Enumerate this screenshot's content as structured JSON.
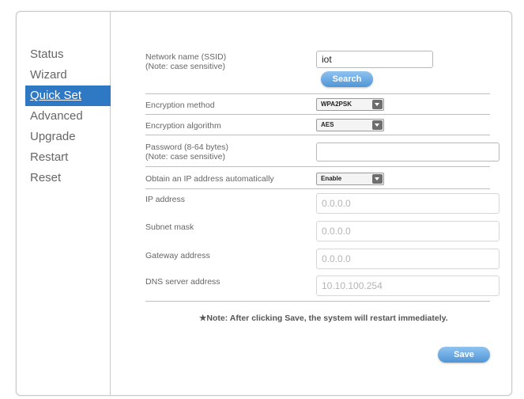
{
  "nav": {
    "items": [
      {
        "label": "Status"
      },
      {
        "label": "Wizard"
      },
      {
        "label": "Quick Set"
      },
      {
        "label": "Advanced"
      },
      {
        "label": "Upgrade"
      },
      {
        "label": "Restart"
      },
      {
        "label": "Reset"
      }
    ],
    "active_index": 2
  },
  "form": {
    "ssid": {
      "label": "Network name (SSID)",
      "sublabel": "(Note: case sensitive)",
      "value": "iot"
    },
    "search_button": "Search",
    "encryption_method": {
      "label": "Encryption method",
      "value": "WPA2PSK"
    },
    "encryption_algorithm": {
      "label": "Encryption algorithm",
      "value": "AES"
    },
    "password": {
      "label": "Password (8-64 bytes)",
      "sublabel": "(Note: case sensitive)",
      "value": ""
    },
    "obtain_ip": {
      "label": "Obtain an IP address automatically",
      "value": "Enable"
    },
    "ip_address": {
      "label": "IP address",
      "value": "0.0.0.0"
    },
    "subnet_mask": {
      "label": "Subnet mask",
      "value": "0.0.0.0"
    },
    "gateway": {
      "label": "Gateway address",
      "value": "0.0.0.0"
    },
    "dns": {
      "label": "DNS server address",
      "value": "10.10.100.254"
    }
  },
  "note": "★Note: After clicking Save, the system will restart immediately.",
  "save_button": "Save",
  "colors": {
    "accent": "#2f78c4",
    "button": "#5a9fe0"
  }
}
